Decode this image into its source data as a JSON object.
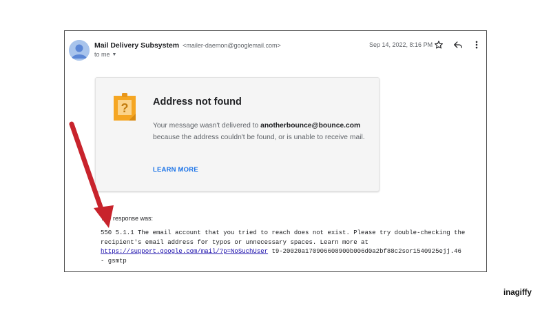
{
  "email": {
    "sender_name": "Mail Delivery Subsystem",
    "sender_email": "<mailer-daemon@googlemail.com>",
    "to_label": "to me",
    "date": "Sep 14, 2022, 8:16 PM"
  },
  "icons": {
    "avatar": "person-icon",
    "star": "star-icon",
    "reply": "reply-icon",
    "more": "more-vert-icon",
    "card": "question-mark-note-icon",
    "dropdown": "caret-down-icon"
  },
  "card": {
    "title": "Address not found",
    "message_prefix": "Your message wasn't delivered to",
    "recipient": "anotherbounce@bounce.com",
    "message_suffix": "because the address couldn't be found, or is unable to receive mail.",
    "link": "LEARN MORE"
  },
  "response": {
    "label": "The response was:",
    "text_before": "550 5.1.1 The email account that you tried to reach does not exist. Please try double-checking the recipient's email address for typos or unnecessary spaces. Learn more at ",
    "link": "https://support.google.com/mail/?p=NoSuchUser",
    "text_after": " t9-20020a170906608900b006d0a2bf88c2sor1540925ejj.46 - gsmtp"
  },
  "brand": "inagiffy",
  "colors": {
    "link_blue": "#1a73e8",
    "arrow_red": "#c8232c",
    "note_orange": "#f5a623"
  }
}
